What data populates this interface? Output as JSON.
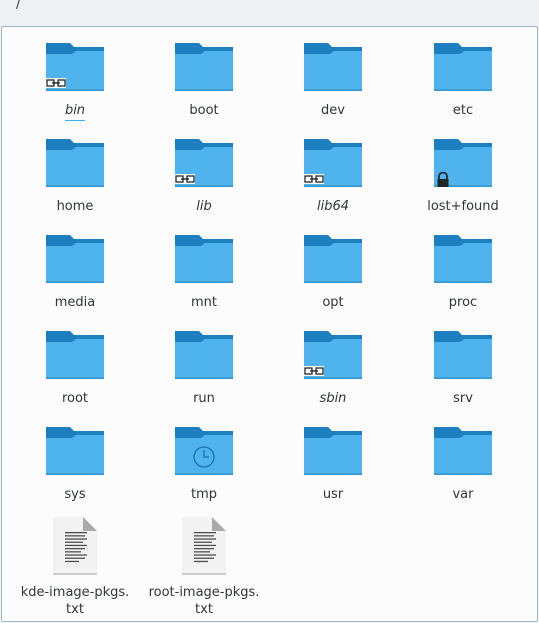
{
  "location": {
    "path": "/"
  },
  "items": [
    {
      "name": "bin",
      "type": "folder",
      "symlink": true,
      "emblem": "link-icon"
    },
    {
      "name": "boot",
      "type": "folder"
    },
    {
      "name": "dev",
      "type": "folder"
    },
    {
      "name": "etc",
      "type": "folder"
    },
    {
      "name": "home",
      "type": "folder"
    },
    {
      "name": "lib",
      "type": "folder",
      "symlink": true,
      "emblem": "link-icon"
    },
    {
      "name": "lib64",
      "type": "folder",
      "symlink": true,
      "emblem": "link-icon"
    },
    {
      "name": "lost+found",
      "type": "folder",
      "emblem": "lock-icon"
    },
    {
      "name": "media",
      "type": "folder"
    },
    {
      "name": "mnt",
      "type": "folder"
    },
    {
      "name": "opt",
      "type": "folder"
    },
    {
      "name": "proc",
      "type": "folder"
    },
    {
      "name": "root",
      "type": "folder"
    },
    {
      "name": "run",
      "type": "folder"
    },
    {
      "name": "sbin",
      "type": "folder",
      "symlink": true,
      "emblem": "link-icon"
    },
    {
      "name": "srv",
      "type": "folder"
    },
    {
      "name": "sys",
      "type": "folder"
    },
    {
      "name": "tmp",
      "type": "folder",
      "overlay": "clock-icon"
    },
    {
      "name": "usr",
      "type": "folder"
    },
    {
      "name": "var",
      "type": "folder"
    },
    {
      "name": "kde-image-pkgs.\ntxt",
      "type": "text-file"
    },
    {
      "name": "root-image-pkgs.\ntxt",
      "type": "text-file"
    }
  ],
  "colors": {
    "folder_back": "#1d7fbf",
    "folder_front": "#4fb3ee",
    "folder_front_light": "#5dbcf3",
    "accent": "#3daee9",
    "view_border": "#9fb8cf"
  }
}
